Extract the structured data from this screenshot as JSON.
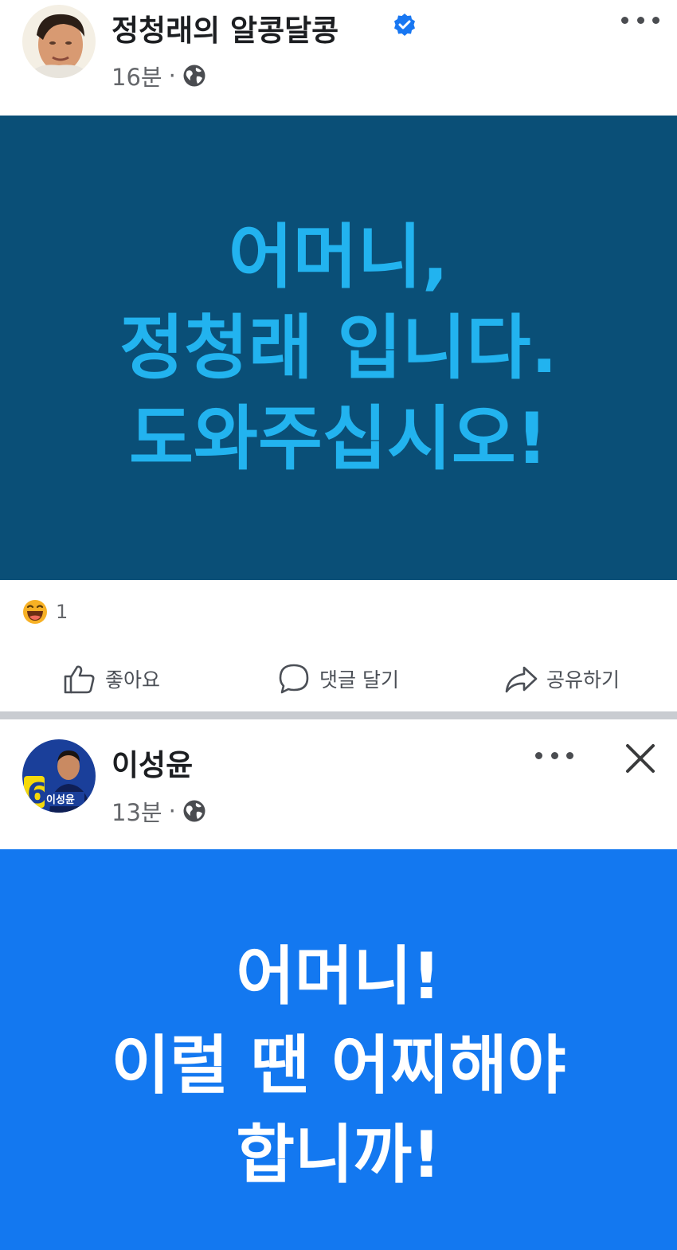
{
  "posts": [
    {
      "author": "정청래의 알콩달콩",
      "verified": true,
      "time": "16분",
      "separator": "·",
      "privacy_icon": "globe-icon",
      "banner": {
        "lines": [
          "어머니,",
          "정청래 입니다.",
          "도와주십시오!"
        ],
        "background": "#0a4f77",
        "text_color": "#22b3ef"
      },
      "reactions": {
        "icon": "laughing-emoji-icon",
        "count": "1"
      },
      "actions": {
        "like": "좋아요",
        "comment": "댓글 달기",
        "share": "공유하기"
      }
    },
    {
      "author": "이성윤",
      "time": "13분",
      "separator": "·",
      "privacy_icon": "globe-icon",
      "banner": {
        "lines": [
          "어머니!",
          "이럴 땐 어찌해야",
          "합니까!"
        ],
        "background": "#1378f0",
        "text_color": "#ffffff"
      }
    }
  ],
  "colors": {
    "secondary_text": "#65676b",
    "verified_blue": "#1877f2",
    "divider": "#c9ccd1"
  }
}
